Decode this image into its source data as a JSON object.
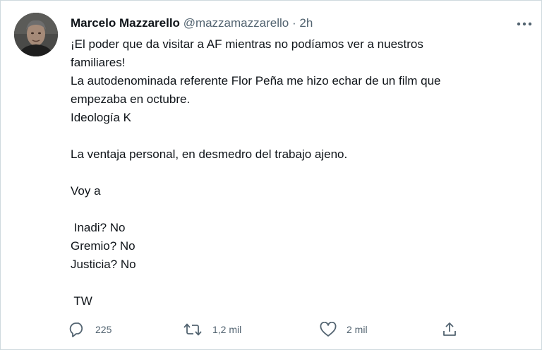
{
  "tweet": {
    "author_name": "Marcelo Mazzarello",
    "handle": "@mazzamazzarello",
    "separator": "·",
    "time": "2h",
    "lines": [
      "¡El poder que da visitar a AF mientras no podíamos ver a nuestros",
      "familiares!",
      "La autodenominada referente Flor Peña me hizo echar de un film que",
      "empezaba en octubre.",
      "Ideología K",
      "",
      "La ventaja personal, en desmedro del trabajo ajeno.",
      "",
      "Voy a",
      "",
      " Inadi? No",
      "Gremio? No",
      "Justicia? No",
      "",
      " TW"
    ]
  },
  "actions": {
    "reply": {
      "icon": "reply-icon",
      "count": "225"
    },
    "retweet": {
      "icon": "retweet-icon",
      "count": "1,2 mil"
    },
    "like": {
      "icon": "heart-icon",
      "count": "2 mil"
    },
    "share": {
      "icon": "share-icon"
    }
  },
  "colors": {
    "text": "#0f1419",
    "secondary": "#536471",
    "border": "#cfd9de"
  }
}
